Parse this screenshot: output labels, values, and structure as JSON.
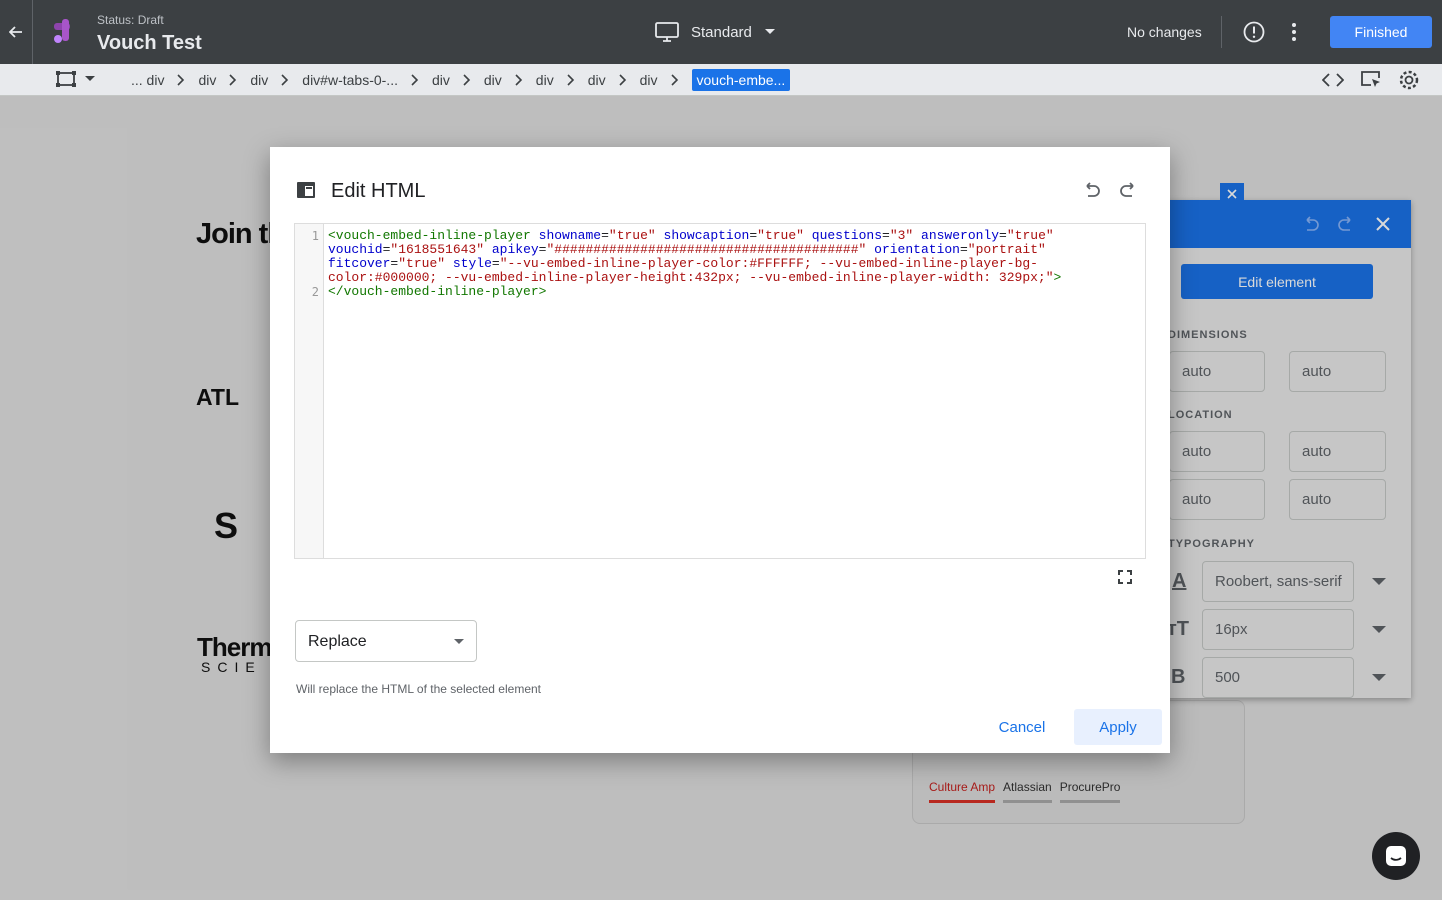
{
  "topbar": {
    "status": "Status: Draft",
    "experience_name": "Vouch Test",
    "device_label": "Standard",
    "changes_label": "No changes",
    "finished_label": "Finished"
  },
  "breadcrumbs": [
    "... div",
    "div",
    "div",
    "div#w-tabs-0-...",
    "div",
    "div",
    "div",
    "div",
    "div",
    "vouch-embe..."
  ],
  "preview": {
    "heading_fragment": "Join th",
    "logo_1": "ATL",
    "logo_2": "S",
    "logo_3a": "Therm",
    "logo_3b": "SCIE",
    "tabs": [
      "Culture Amp",
      "Atlassian",
      "ProcurePro"
    ]
  },
  "panel": {
    "edit_element_label": "Edit element",
    "dimensions_label": "DIMENSIONS",
    "location_label": "LOCATION",
    "typography_label": "TYPOGRAPHY",
    "width": "auto",
    "height": "auto",
    "loc_top": "auto",
    "loc_right": "auto",
    "loc_bottom": "auto",
    "loc_left": "auto",
    "font_family": "Roobert, sans-serif",
    "font_size": "16px",
    "font_weight": "500"
  },
  "dialog": {
    "title": "Edit HTML",
    "line_numbers": [
      "1",
      "2"
    ],
    "code": {
      "open_tag": "<vouch-embed-inline-player",
      "a1": "showname",
      "v1": "\"true\"",
      "a2": "showcaption",
      "v2": "\"true\"",
      "a3": "questions",
      "v3": "\"3\"",
      "a4": "answeronly",
      "v4": "\"true\"",
      "a5": "vouchid",
      "v5": "\"1618551643\"",
      "a6": "apikey",
      "v6": "\"#######################################\"",
      "a7": "orientation",
      "v7": "\"portrait\"",
      "a8": "fitcover",
      "v8": "\"true\"",
      "a9": "style",
      "v9a": "\"--vu-embed-inline-player-color:#FFFFFF; --vu-embed-inline-player-bg-",
      "v9b": "color:#000000; --vu-embed-inline-player-height:432px; --vu-embed-inline-player-width: 329px;\"",
      "close_bracket": ">",
      "close_tag": "</vouch-embed-inline-player>"
    },
    "mode_selected": "Replace",
    "hint": "Will replace the HTML of the selected element",
    "cancel_label": "Cancel",
    "apply_label": "Apply"
  }
}
